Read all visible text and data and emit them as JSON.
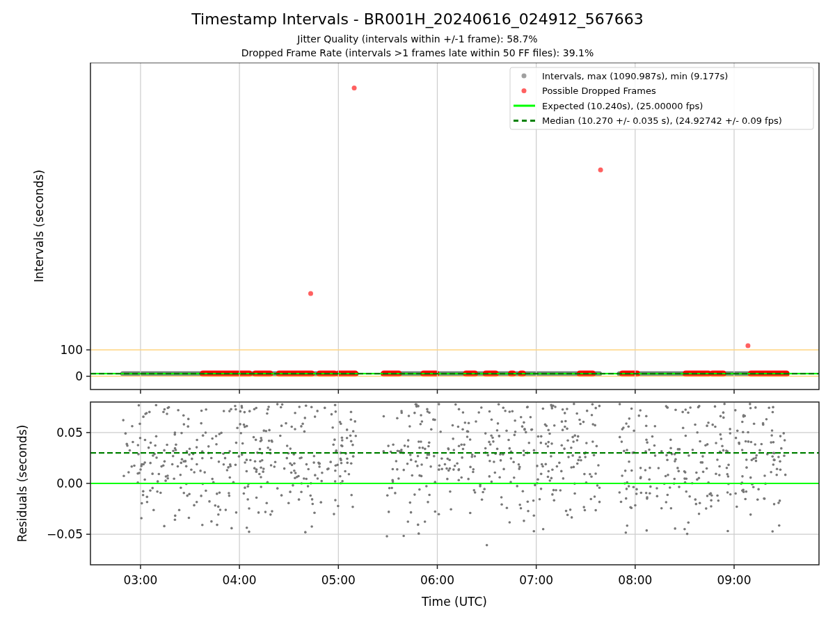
{
  "title": "Timestamp Intervals - BR001H_20240616_024912_567663",
  "subtitles": [
    "Jitter Quality (intervals within +/-1 frame): 58.7%",
    "Dropped Frame Rate (intervals >1 frames late within 50 FF files): 39.1%"
  ],
  "legend": [
    {
      "kind": "marker",
      "label": "Intervals, max (1090.987s), min (9.177s)",
      "color": "#a0a0a0"
    },
    {
      "kind": "marker",
      "label": "Possible Dropped Frames",
      "color": "#ff6060"
    },
    {
      "kind": "line",
      "label": "Expected (10.240s), (25.00000 fps)",
      "color": "#00ff00"
    },
    {
      "kind": "dashed",
      "label": "Median (10.270 +/- 0.035 s), (24.92742 +/- 0.09 fps)",
      "color": "#008000"
    }
  ],
  "top_chart": {
    "chart_data": {
      "type": "scatter",
      "ylabel": "Intervals (seconds)",
      "x": [
        2.494,
        4.72,
        5.16,
        7.65,
        9.14,
        9.858
      ],
      "series": [
        {
          "color": "#ff6060",
          "values": [
            null,
            313,
            1091,
            781,
            116,
            null
          ]
        },
        {
          "type": "line",
          "color": "#00ff00",
          "values": [
            10.24,
            10.24,
            10.24,
            10.24,
            10.24,
            10.24
          ]
        },
        {
          "type": "line",
          "color": "#008000",
          "values": [
            10.27,
            10.27,
            10.27,
            10.27,
            10.27,
            10.27
          ],
          "line_style": "dashed"
        }
      ],
      "xlim": [
        2.494,
        9.858
      ],
      "ylim": [
        -50,
        1187
      ],
      "grid": true,
      "yticks": [
        {
          "value": 0,
          "label": "0"
        },
        {
          "value": 100,
          "label": "100"
        }
      ]
    }
  },
  "bottom_chart": {
    "chart_data": {
      "type": "line",
      "xlabel": "Time (UTC)",
      "ylabel": "Residuals (seconds)",
      "x": [
        2.494,
        9.858
      ],
      "series": [
        {
          "color": "#00ff00",
          "values": [
            0,
            0
          ]
        },
        {
          "color": "#008000",
          "values": [
            0.03,
            0.03
          ],
          "line_style": "dashed"
        }
      ],
      "xlim": [
        2.494,
        9.858
      ],
      "ylim": [
        -0.08,
        0.08
      ],
      "grid": true,
      "xticks": [
        {
          "value": 3,
          "label": "03:00"
        },
        {
          "value": 4,
          "label": "04:00"
        },
        {
          "value": 5,
          "label": "05:00"
        },
        {
          "value": 6,
          "label": "06:00"
        },
        {
          "value": 7,
          "label": "07:00"
        },
        {
          "value": 8,
          "label": "08:00"
        },
        {
          "value": 9,
          "label": "09:00"
        }
      ],
      "yticks": [
        {
          "value": 0.05,
          "label": "0.05"
        },
        {
          "value": 0,
          "label": "0.00"
        },
        {
          "value": -0.05,
          "label": "−0.05"
        }
      ]
    }
  }
}
